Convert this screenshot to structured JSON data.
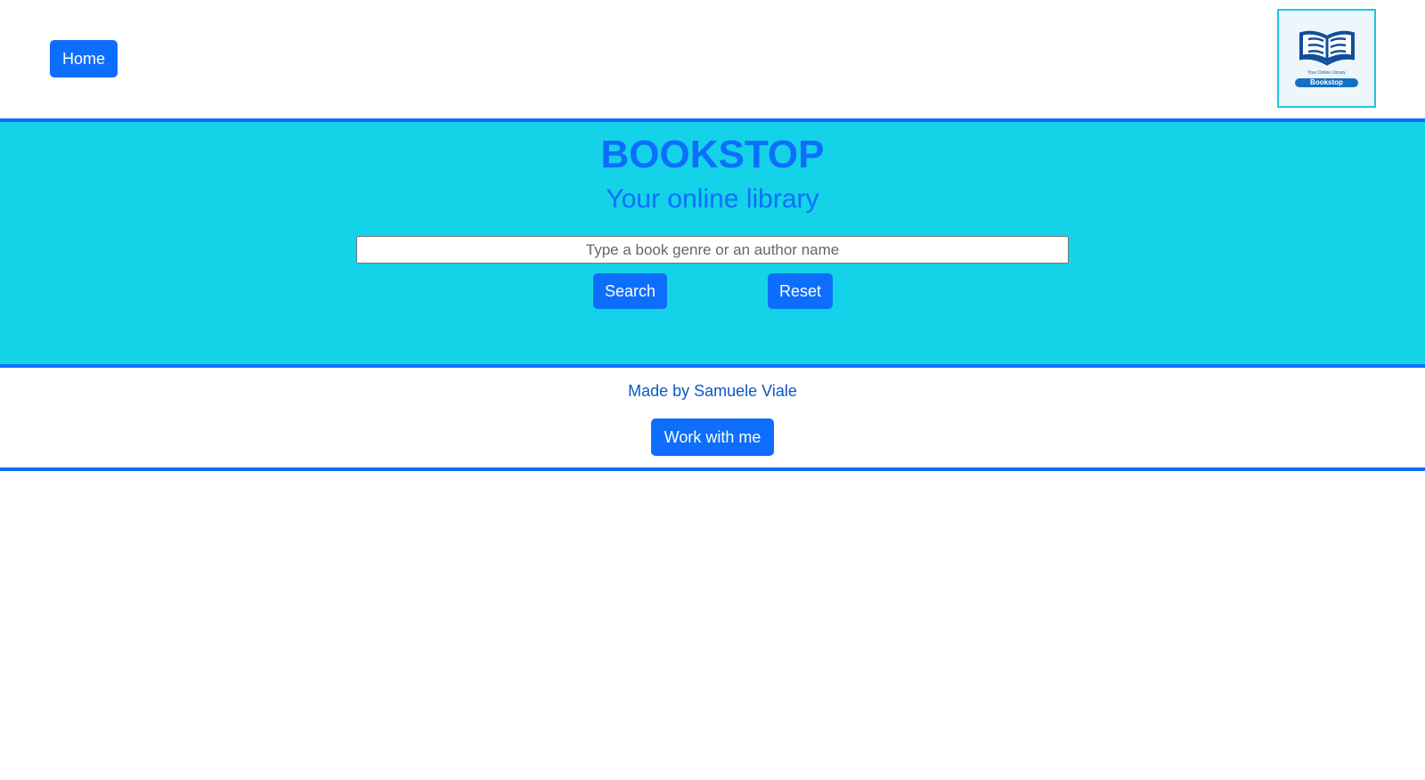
{
  "nav": {
    "home_label": "Home"
  },
  "logo": {
    "tagline": "Your Online Library",
    "name": "Bookstop"
  },
  "hero": {
    "title": "BOOKSTOP",
    "subtitle": "Your online library",
    "search_placeholder": "Type a book genre or an author name",
    "search_value": "",
    "search_label": "Search",
    "reset_label": "Reset"
  },
  "footer": {
    "credit": "Made by Samuele Viale",
    "work_label": "Work with me"
  },
  "colors": {
    "primary": "#0d6efd",
    "hero_background": "#14d2e8",
    "logo_border": "#1fc7de"
  }
}
